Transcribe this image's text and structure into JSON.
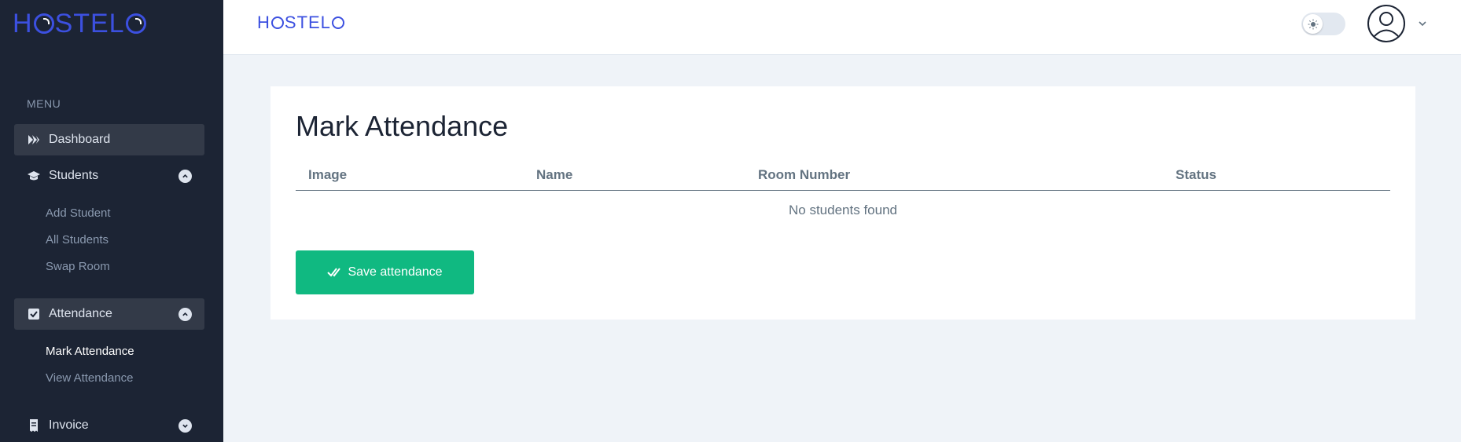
{
  "brand": {
    "sidebar_logo_prefix": "H",
    "sidebar_logo_suffix": "STEL",
    "header_logo_prefix": "H",
    "header_logo_suffix": "STEL",
    "color": "#3c50e0"
  },
  "sidebar": {
    "menu_heading": "MENU",
    "items": [
      {
        "label": "Dashboard",
        "icon": "dashboard-icon",
        "active": true
      },
      {
        "label": "Students",
        "icon": "graduation-cap-icon",
        "expanded": true,
        "children": [
          {
            "label": "Add Student"
          },
          {
            "label": "All Students"
          },
          {
            "label": "Swap Room"
          }
        ]
      },
      {
        "label": "Attendance",
        "icon": "checkbox-icon",
        "active": true,
        "expanded": true,
        "children": [
          {
            "label": "Mark Attendance",
            "active": true
          },
          {
            "label": "View Attendance"
          }
        ]
      },
      {
        "label": "Invoice",
        "icon": "receipt-icon",
        "expanded": false
      }
    ]
  },
  "header": {
    "theme_toggle_icon": "sun-icon",
    "avatar_icon": "user-avatar-icon",
    "caret_icon": "chevron-down-icon"
  },
  "main": {
    "title": "Mark Attendance",
    "table": {
      "columns": [
        "Image",
        "Name",
        "Room Number",
        "Status"
      ],
      "empty_message": "No students found"
    },
    "save_button": {
      "label": "Save attendance",
      "icon": "double-check-icon",
      "color": "#10b981"
    }
  },
  "colors": {
    "sidebar_bg": "#1c2434",
    "page_bg": "#eff3f8",
    "accent": "#3c50e0",
    "success": "#10b981"
  }
}
